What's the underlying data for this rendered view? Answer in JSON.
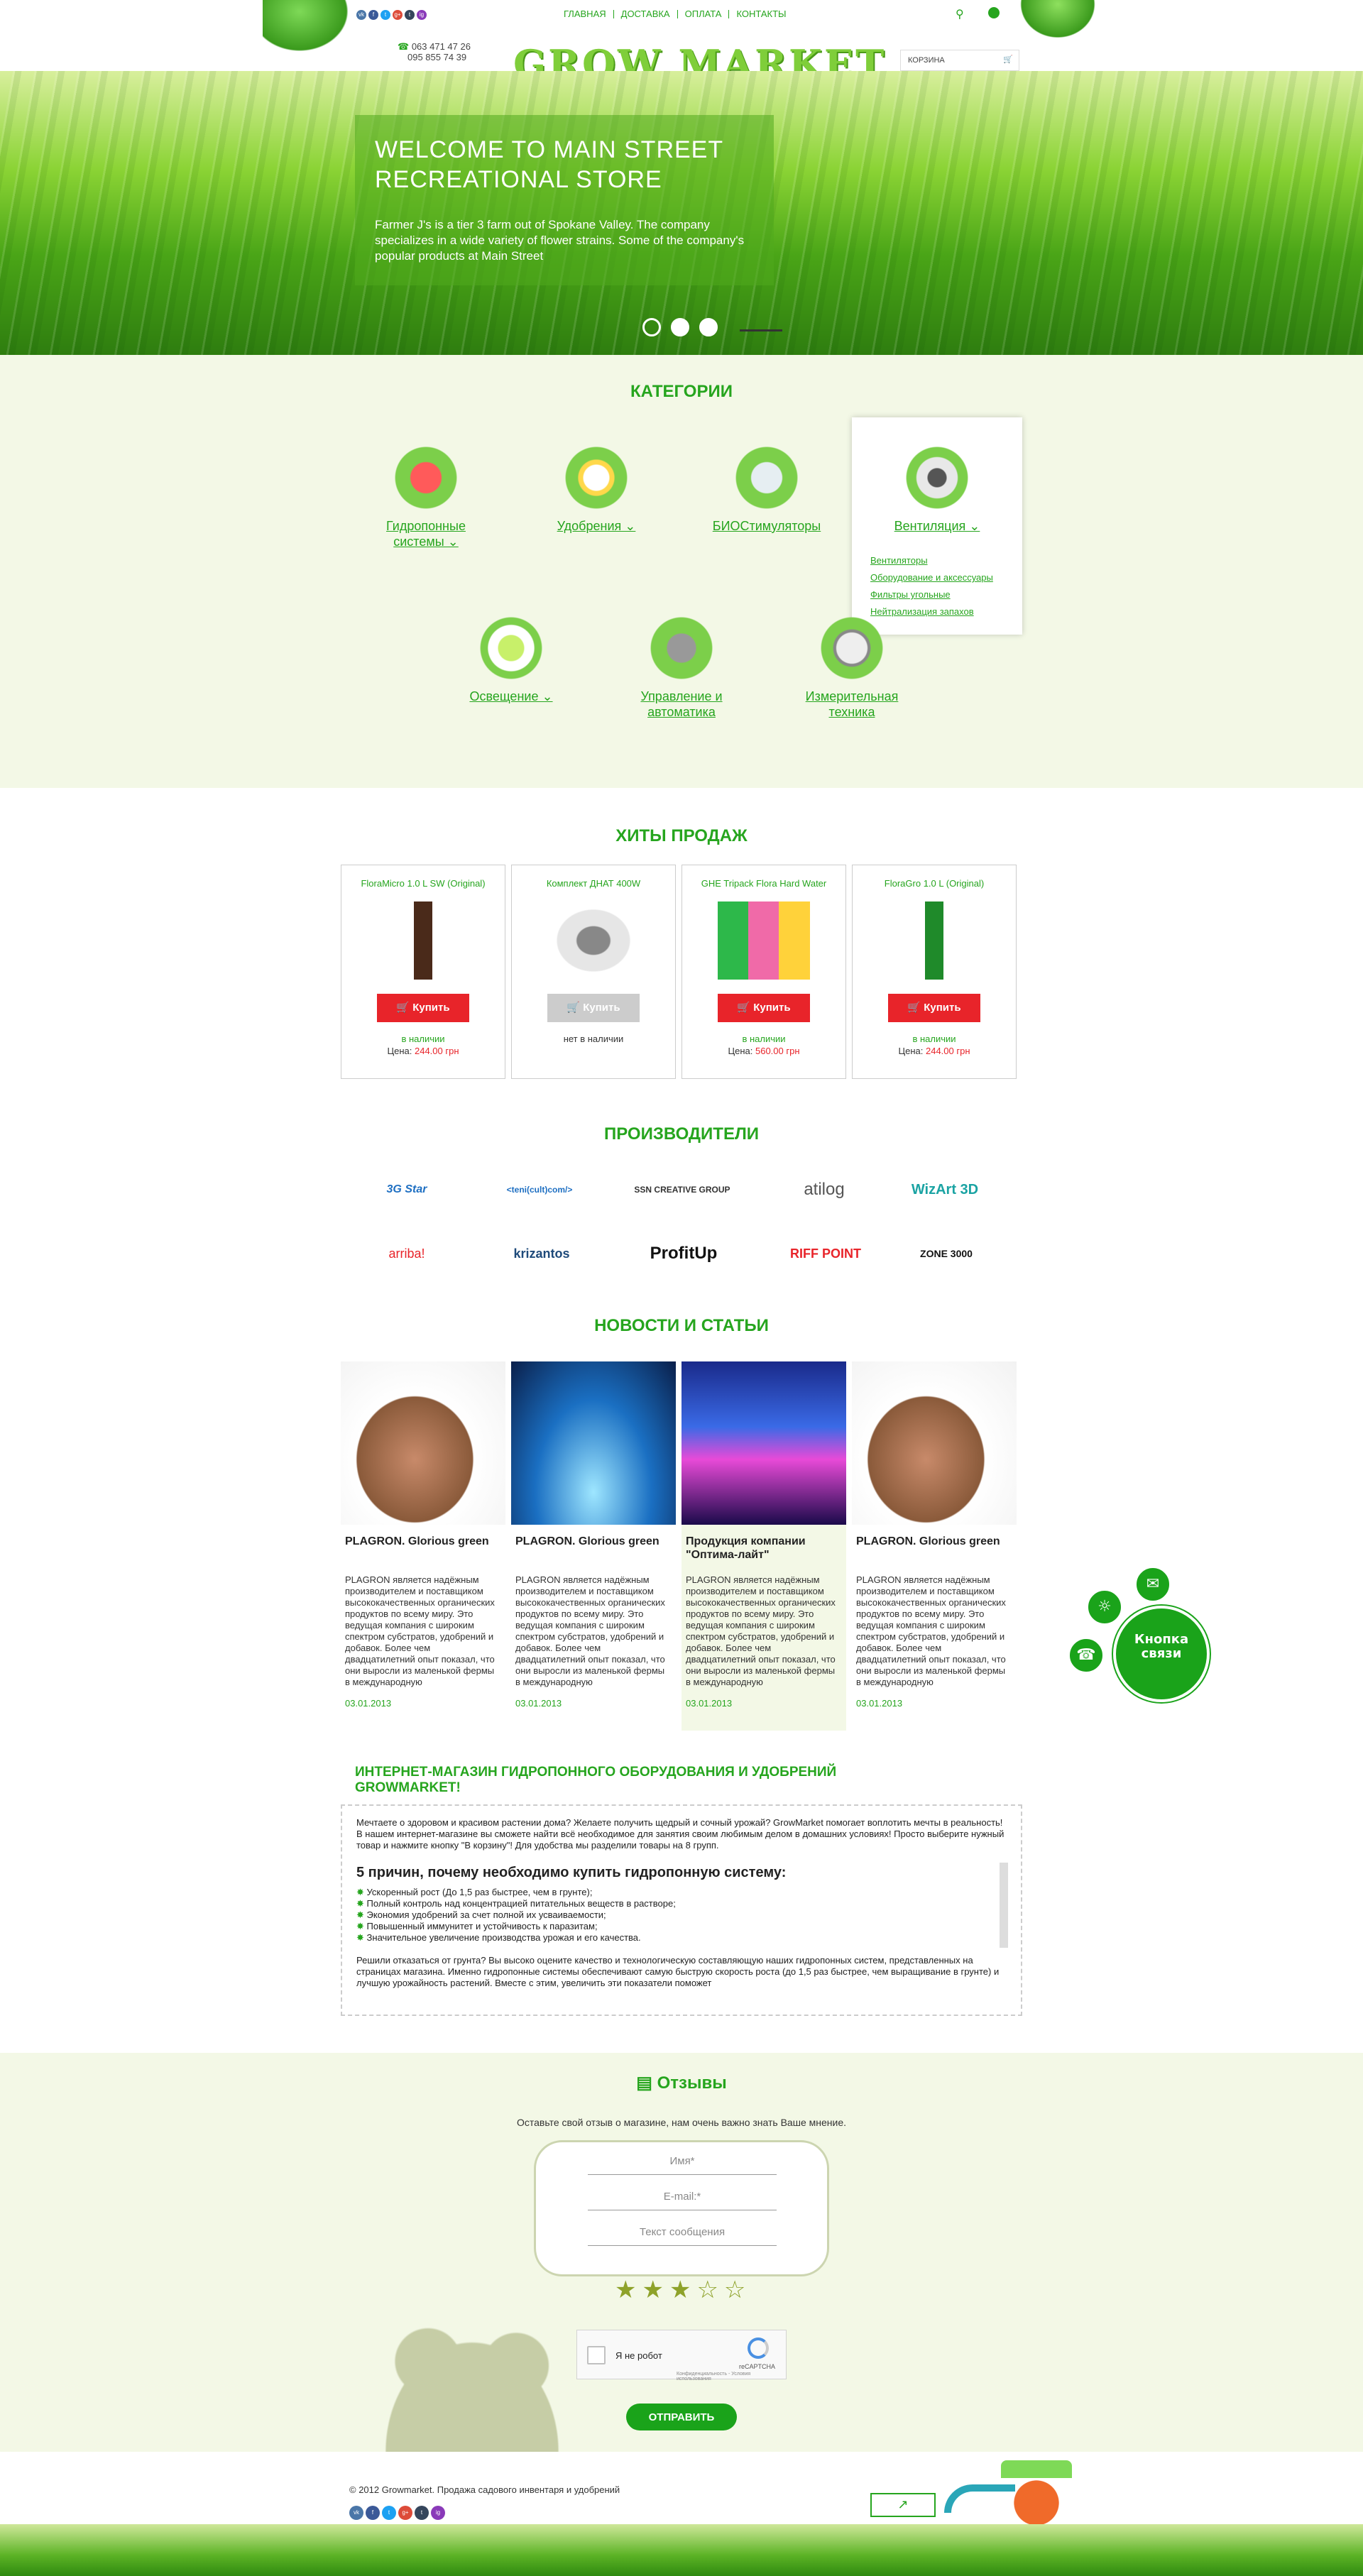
{
  "header": {
    "nav": [
      "ГЛАВНАЯ",
      "ДОСТАВКА",
      "ОПЛАТА",
      "КОНТАКТЫ"
    ],
    "phones": [
      "063 471 47 26",
      "095 855 74 39"
    ],
    "logo": "GROW MARKET",
    "cart_label": "КОРЗИНА",
    "social": [
      "vk",
      "f",
      "t",
      "g+",
      "t",
      "ig"
    ]
  },
  "hero": {
    "title": "WELCOME TO MAIN STREET RECREATIONAL STORE",
    "text": "Farmer J's is a tier 3 farm out of Spokane Valley. The company specializes in a wide variety of flower strains. Some of the company's popular products at Main Street"
  },
  "categories": {
    "heading": "КАТЕГОРИИ",
    "items": [
      {
        "label": "Гидропонные системы ⌄",
        "icon": "watering-can-icon"
      },
      {
        "label": "Удобрения ⌄",
        "icon": "fertilizer-icon"
      },
      {
        "label": "БИОСтимуляторы",
        "icon": "flask-icon"
      },
      {
        "label": "Вентиляция ⌄",
        "icon": "fan-icon"
      },
      {
        "label": "Освещение ⌄",
        "icon": "lamp-icon"
      },
      {
        "label": "Управление и автоматика",
        "icon": "gears-icon"
      },
      {
        "label": "Измерительная техника",
        "icon": "gauge-icon"
      }
    ],
    "submenu": [
      "Вентиляторы",
      "Оборудование и аксессуары",
      "Фильтры угольные",
      "Нейтрализация запахов"
    ]
  },
  "hits": {
    "heading": "ХИТЫ ПРОДАЖ",
    "products": [
      {
        "name": "FloraMicro 1.0 L SW (Original)",
        "buy": "Купить",
        "status": "в наличии",
        "price_label": "Цена:",
        "price": "244.00 грн",
        "available": true
      },
      {
        "name": "Комплект ДНАТ 400W",
        "buy": "Купить",
        "status": "нет в наличии",
        "price_label": "",
        "price": "",
        "available": false
      },
      {
        "name": "GHE Tripack Flora Hard Water",
        "buy": "Купить",
        "status": "в наличии",
        "price_label": "Цена:",
        "price": "560.00 грн",
        "available": true
      },
      {
        "name": "FloraGro 1.0 L (Original)",
        "buy": "Купить",
        "status": "в наличии",
        "price_label": "Цена:",
        "price": "244.00 грн",
        "available": true
      }
    ]
  },
  "brands": {
    "heading": "ПРОИЗВОДИТЕЛИ",
    "row1": [
      "3G Star",
      "<teni(cult)com/>",
      "SSN CREATIVE GROUP",
      "atilog",
      "WizArt 3D"
    ],
    "row2": [
      "arriba!",
      "krizantos",
      "ProfitUp",
      "RIFF POINT",
      "ZONE 3000"
    ]
  },
  "news": {
    "heading": "НОВОСТИ И СТАТЬИ",
    "items": [
      {
        "title": "PLAGRON. Glorious green",
        "text": "PLAGRON является надёжным производителем и поставщиком высококачественных органических продуктов по всему миру. Это ведущая компания с широким спектром субстратов, удобрений и добавок. Более чем двадцатилетний опыт показал, что они выросли из маленькой фермы в международную",
        "date": "03.01.2013"
      },
      {
        "title": "PLAGRON. Glorious green",
        "text": "PLAGRON является надёжным производителем и поставщиком высококачественных органических продуктов по всему миру. Это ведущая компания с широким спектром субстратов, удобрений и добавок. Более чем двадцатилетний опыт показал, что они выросли из маленькой фермы в международную",
        "date": "03.01.2013"
      },
      {
        "title": "Продукция компании \"Оптима-лайт\"",
        "text": "PLAGRON является надёжным производителем и поставщиком высококачественных органических продуктов по всему миру. Это ведущая компания с широким спектром субстратов, удобрений и добавок. Более чем двадцатилетний опыт показал, что они выросли из маленькой фермы в международную",
        "date": "03.01.2013"
      },
      {
        "title": "PLAGRON. Glorious green",
        "text": "PLAGRON является надёжным производителем и поставщиком высококачественных органических продуктов по всему миру. Это ведущая компания с широким спектром субстратов, удобрений и добавок. Более чем двадцатилетний опыт показал, что они выросли из маленькой фермы в международную",
        "date": "03.01.2013"
      }
    ]
  },
  "contact_button": "Кнопка связи",
  "about": {
    "heading": "ИНТЕРНЕТ-МАГАЗИН ГИДРОПОННОГО ОБОРУДОВАНИЯ И УДОБРЕНИЙ GROWMARKET!",
    "intro": "Мечтаете о здоровом и красивом растении дома? Желаете получить щедрый и сочный урожай? GrowMarket помогает воплотить мечты в реальность! В нашем интернет-магазине вы сможете найти всё необходимое для занятия своим любимым делом в домашних условиях! Просто выберите нужный товар и нажмите кнопку \"В корзину\"! Для удобства мы разделили товары на 8 групп.",
    "subheading": "5 причин, почему необходимо купить гидропонную систему:",
    "reasons": [
      "Ускоренный рост (До 1,5 раз быстрее, чем в грунте);",
      "Полный контроль над концентрацией питательных веществ в растворе;",
      "Экономия удобрений за счет полной их усваиваемости;",
      "Повышенный иммунитет и устойчивость к паразитам;",
      "Значительное увеличение производства урожая и его качества."
    ],
    "outro": "Решили отказаться от грунта? Вы высоко оцените качество и технологическую составляющую наших гидропонных систем, представленных на страницах магазина. Именно гидропонные системы обеспечивают самую быструю скорость роста (до 1,5 раз быстрее, чем выращивание в грунте) и лучшую урожайность растений. Вместе с этим, увеличить эти показатели поможет"
  },
  "reviews": {
    "heading": "Отзывы",
    "subtitle": "Оставьте свой отзыв о магазине, нам очень важно знать Ваше мнение.",
    "name_placeholder": "Имя*",
    "email_placeholder": "E-mail:*",
    "message_placeholder": "Текст сообщения",
    "rating": 3,
    "rating_max": 5,
    "captcha_label": "Я не робот",
    "captcha_brand": "reCAPTCHA",
    "captcha_links": "Конфиденциальность - Условия использования",
    "send": "ОТПРАВИТЬ"
  },
  "footer": {
    "copyright": "© 2012 Growmarket. Продажа садового инвентаря и удобрений",
    "social": [
      "vk",
      "f",
      "t",
      "g+",
      "t",
      "ig"
    ]
  },
  "colors": {
    "accent": "#26a51e",
    "buy": "#e8242a",
    "bg_soft": "#f3f8e6"
  }
}
